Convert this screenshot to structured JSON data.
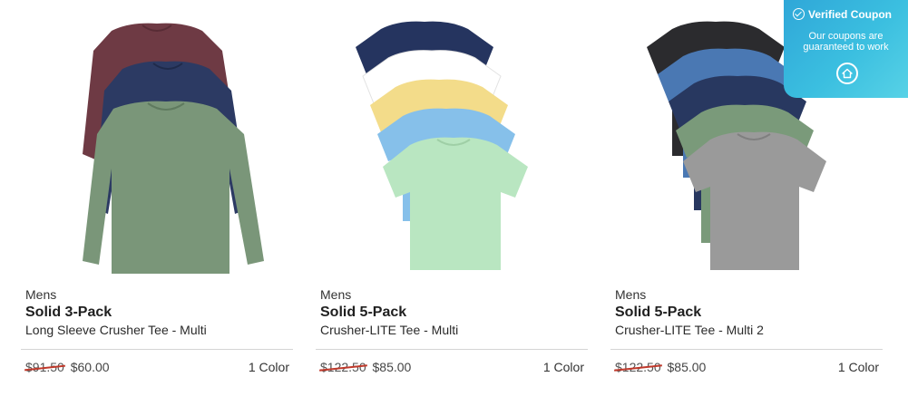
{
  "products": [
    {
      "category": "Mens",
      "title": "Solid 3-Pack",
      "subtitle": "Long Sleeve Crusher Tee - Multi",
      "old_price": "$91.50",
      "price": "$60.00",
      "colors": "1 Color",
      "shirt_colors": [
        "#6e3a44",
        "#2c3a63",
        "#7a9679"
      ]
    },
    {
      "category": "Mens",
      "title": "Solid 5-Pack",
      "subtitle": "Crusher-LITE Tee - Multi",
      "old_price": "$122.50",
      "price": "$85.00",
      "colors": "1 Color",
      "shirt_colors": [
        "#25345f",
        "#ffffff",
        "#f3dc8a",
        "#86c0ea",
        "#b9e6c1"
      ]
    },
    {
      "category": "Mens",
      "title": "Solid 5-Pack",
      "subtitle": "Crusher-LITE Tee - Multi 2",
      "old_price": "$122.50",
      "price": "$85.00",
      "colors": "1 Color",
      "shirt_colors": [
        "#2b2b2e",
        "#4a78b3",
        "#283860",
        "#7a9a7a",
        "#9a9a9a"
      ]
    }
  ],
  "coupon": {
    "heading": "Verified Coupon",
    "description": "Our coupons are guaranteed to work",
    "icon": "house-logo-icon"
  }
}
